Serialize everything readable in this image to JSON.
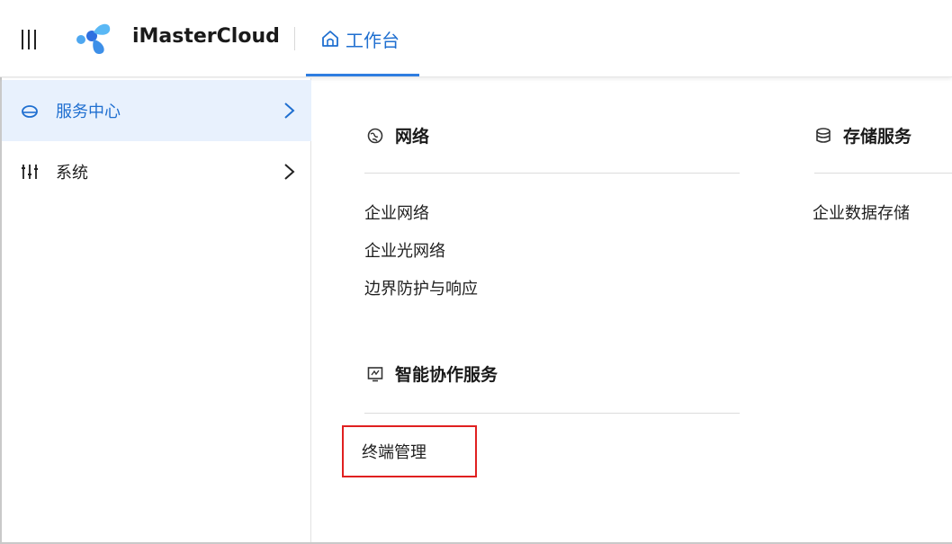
{
  "topbar": {
    "brand": "iMasterCloud",
    "tab": {
      "label": "工作台"
    },
    "accent_color": "#1f6fd0"
  },
  "sidebar": {
    "items": [
      {
        "label": "服务中心",
        "icon": "cloud-icon",
        "active": true
      },
      {
        "label": "系统",
        "icon": "sliders-icon",
        "active": false
      }
    ]
  },
  "content": {
    "sections": [
      {
        "title": "网络",
        "icon": "globe-icon",
        "links": [
          "企业网络",
          "企业光网络",
          "边界防护与响应"
        ]
      },
      {
        "title": "存储服务",
        "icon": "database-icon",
        "links": [
          "企业数据存储"
        ]
      },
      {
        "title": "智能协作服务",
        "icon": "screen-icon",
        "links": [
          "终端管理"
        ]
      }
    ],
    "highlighted_link": "终端管理",
    "highlight_color": "#e02020"
  }
}
